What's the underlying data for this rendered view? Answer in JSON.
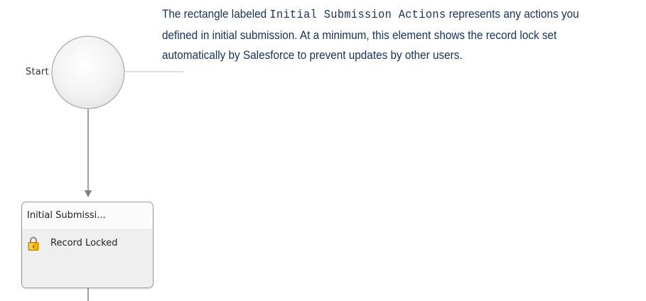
{
  "diagram": {
    "start_label": "Start",
    "node": {
      "title": "Initial Submissi...",
      "action_icon": "lock-icon",
      "action_label": "Record Locked"
    }
  },
  "description": {
    "intro": "The rectangle labeled",
    "code_label": "Initial Submission Actions",
    "body": "represents any actions you defined in initial submission. At a minimum, this element shows the record lock set automatically by Salesforce to prevent updates by other users."
  },
  "colors": {
    "text": "#16325c",
    "connector": "#808080",
    "node_border": "#9a9a9a"
  }
}
